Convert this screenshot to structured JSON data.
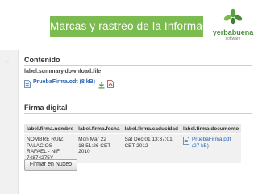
{
  "banner": {
    "title": "Marcas y rastreo de la Información",
    "logo_brand": "yerbabuena",
    "logo_sub": "software",
    "title_bg": "#7bbb4f"
  },
  "sidebar": {
    "marker": "··"
  },
  "contenido": {
    "heading": "Contenido",
    "summary_label": "label.summary.download.file",
    "file_link": "PruebaFirma.odt (8 kB)",
    "icons": [
      "document-icon",
      "download-icon",
      "pdf-icon"
    ]
  },
  "firma": {
    "heading": "Firma digital",
    "columns": [
      "label.firma.nombre",
      "label.firma.fecha",
      "label.firma.caducidad",
      "label.firma.documento"
    ],
    "rows": [
      {
        "nombre": "NOMBRE RUIZ PALACIOS RAFAEL - NIF 74874275Y",
        "fecha": "Mon Mar 22 18:51:26 CET 2010",
        "caducidad": "Sat Dec 01 13:37:01 CET 2012",
        "documento": "PruebaFirma.pdf (27 kB)"
      }
    ],
    "button_label": "Firmar en Nuxeo"
  },
  "colors": {
    "accent": "#7bbb4f",
    "link": "#2a64b3"
  }
}
